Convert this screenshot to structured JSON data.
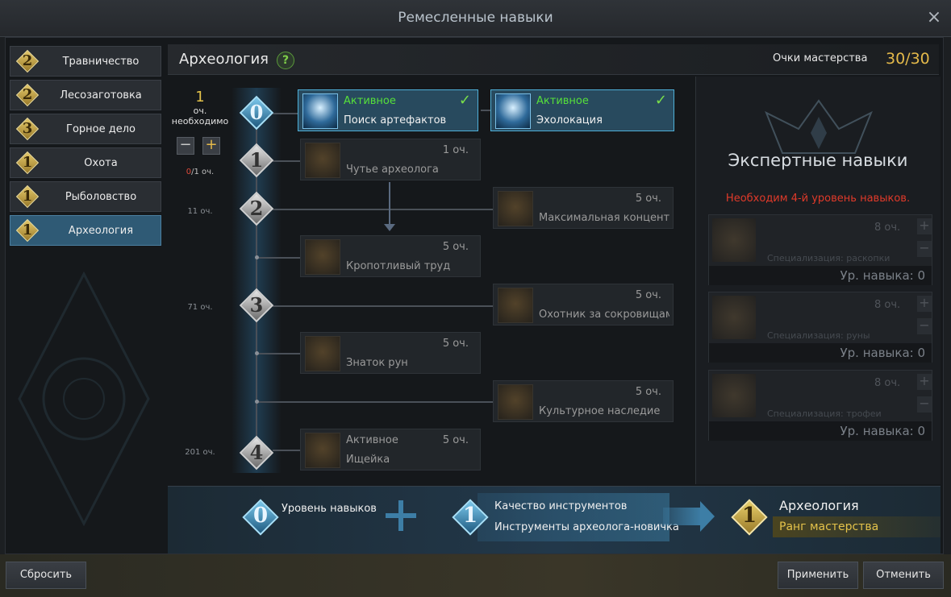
{
  "window": {
    "title": "Ремесленные навыки",
    "close_icon": "×"
  },
  "sidebar": {
    "items": [
      {
        "rank": "2",
        "label": "Травничество",
        "active": false
      },
      {
        "rank": "2",
        "label": "Лесозаготовка",
        "active": false
      },
      {
        "rank": "3",
        "label": "Горное дело",
        "active": false
      },
      {
        "rank": "1",
        "label": "Охота",
        "active": false
      },
      {
        "rank": "1",
        "label": "Рыболовство",
        "active": false
      },
      {
        "rank": "1",
        "label": "Археология",
        "active": true
      }
    ]
  },
  "header": {
    "title": "Археология",
    "help": "?",
    "mastery_label": "Очки мастерства",
    "mastery_value": "30/30"
  },
  "points": {
    "needed_num": "1",
    "needed_text": "оч. необходимо",
    "minus": "−",
    "plus": "+",
    "spent_current": "0",
    "spent_rest": "/1 оч."
  },
  "tiers": [
    {
      "num": "0",
      "req": ""
    },
    {
      "num": "1",
      "req": ""
    },
    {
      "num": "2",
      "req": "11 оч."
    },
    {
      "num": "3",
      "req": "71 оч."
    },
    {
      "num": "4",
      "req": "201 оч."
    }
  ],
  "skills": [
    {
      "state": "Активное",
      "name": "Поиск артефактов",
      "cost": "",
      "active": true
    },
    {
      "state": "Активное",
      "name": "Эхолокация",
      "cost": "",
      "active": true
    },
    {
      "state": "",
      "name": "Чутье археолога",
      "cost": "1 оч.",
      "active": false
    },
    {
      "state": "",
      "name": "Максимальная концентрация",
      "cost": "5 оч.",
      "active": false
    },
    {
      "state": "",
      "name": "Кропотливый труд",
      "cost": "5 оч.",
      "active": false
    },
    {
      "state": "",
      "name": "Охотник за сокровищами",
      "cost": "5 оч.",
      "active": false
    },
    {
      "state": "",
      "name": "Знаток рун",
      "cost": "5 оч.",
      "active": false
    },
    {
      "state": "",
      "name": "Культурное наследие",
      "cost": "5 оч.",
      "active": false
    },
    {
      "state": "Активное",
      "name": "Ищейка",
      "cost": "5 оч.",
      "active": false
    }
  ],
  "expert": {
    "title": "Экспертные навыки",
    "warning": "Необходим 4-й уровень навыков.",
    "cards": [
      {
        "cost": "8 оч.",
        "spec": "Специализация: раскопки",
        "level": "Ур. навыка: 0"
      },
      {
        "cost": "8 оч.",
        "spec": "Специализация: руны",
        "level": "Ур. навыка: 0"
      },
      {
        "cost": "8 оч.",
        "spec": "Специализация: трофеи",
        "level": "Ур. навыка: 0"
      }
    ]
  },
  "bottom": {
    "skill_level_num": "0",
    "skill_level_label": "Уровень навыков",
    "tool_num": "1",
    "tool_quality_label": "Качество инструментов",
    "tool_name": "Инструменты археолога-новичка",
    "result_num": "1",
    "result_title": "Археология",
    "result_rank": "Ранг мастерства"
  },
  "buttons": {
    "reset": "Сбросить",
    "apply": "Применить",
    "cancel": "Отменить"
  },
  "colors": {
    "accent_gold": "#e4b94a",
    "active_green": "#56e03a",
    "warning_red": "#e03a2a",
    "active_blue": "#2f5a75"
  }
}
